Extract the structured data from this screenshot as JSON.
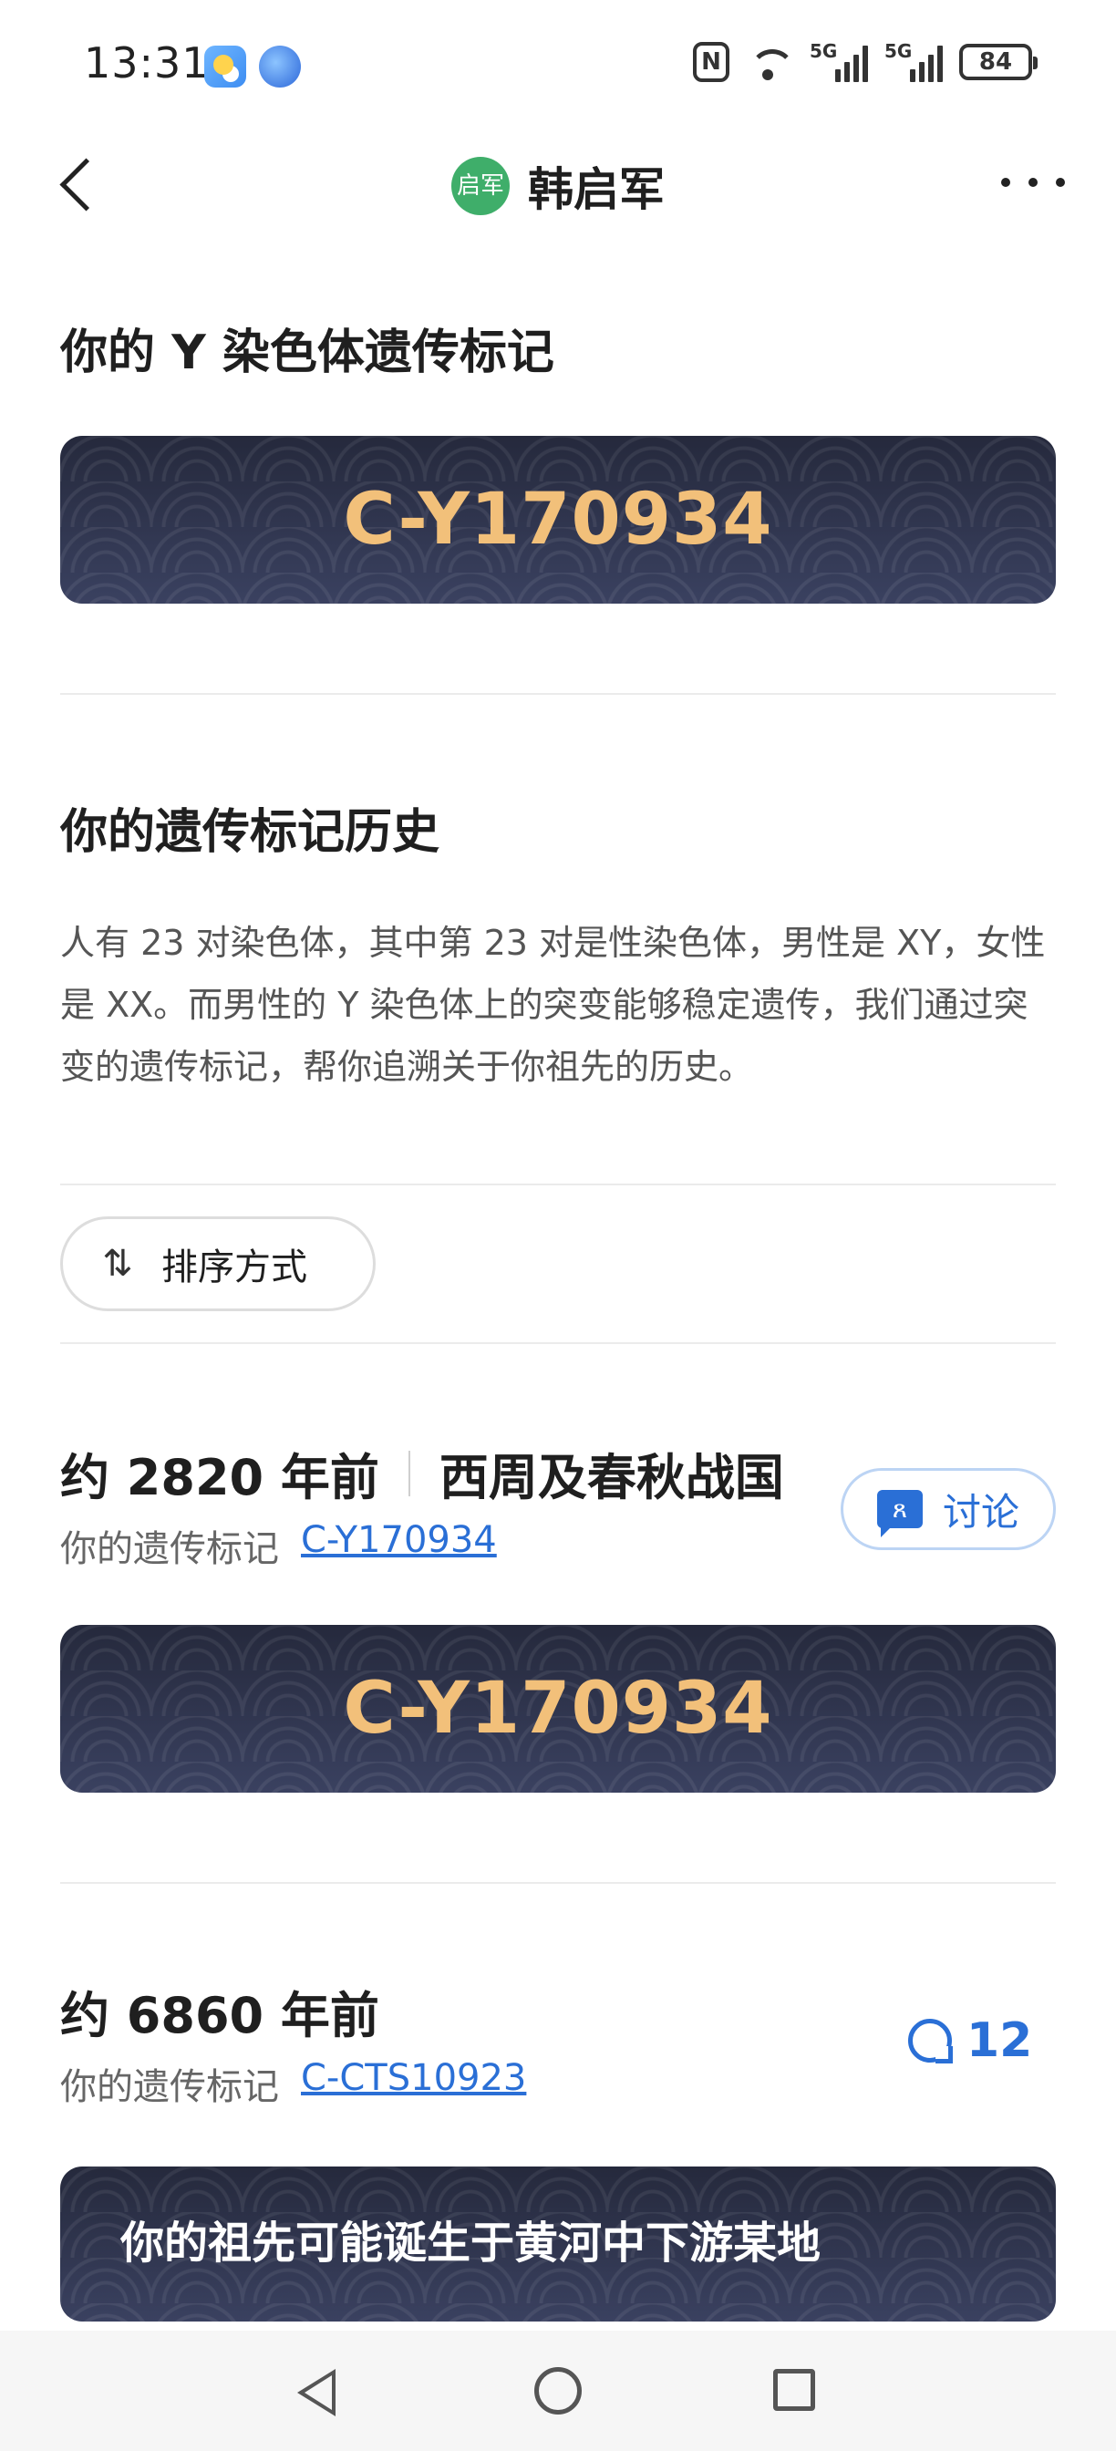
{
  "status_bar": {
    "time": "13:31",
    "battery": "84",
    "icons": [
      "weather-icon",
      "browser-icon",
      "nfc-icon",
      "wifi-icon",
      "signal-icon",
      "signal-icon",
      "battery-icon"
    ],
    "signal_tag_1": "5G",
    "signal_tag_2": "5G"
  },
  "header": {
    "avatar_text": "启军",
    "title": "韩启军",
    "avatar_color": "#3fae6a"
  },
  "y_marker": {
    "title": "你的 Y 染色体遗传标记",
    "code": "C-Y170934"
  },
  "history": {
    "title": "你的遗传标记历史",
    "description": "人有 23 对染色体，其中第 23 对是性染色体，男性是 XY，女性是 XX。而男性的 Y 染色体上的突变能够稳定遗传，我们通过突变的遗传标记，帮你追溯关于你祖先的历史。",
    "sort_label": "排序方式"
  },
  "entries": [
    {
      "time": "约 2820 年前",
      "era": "西周及春秋战国",
      "sub_label": "你的遗传标记",
      "marker": "C-Y170934",
      "action_label": "讨论",
      "card_code": "C-Y170934"
    },
    {
      "time": "约 6860 年前",
      "sub_label": "你的遗传标记",
      "marker": "C-CTS10923",
      "comment_count": "12",
      "origin_text": "你的祖先可能诞生于黄河中下游某地"
    }
  ],
  "colors": {
    "accent": "#2a6fd6",
    "gold": "#f2c07a",
    "card_bg": "#2b3047"
  }
}
